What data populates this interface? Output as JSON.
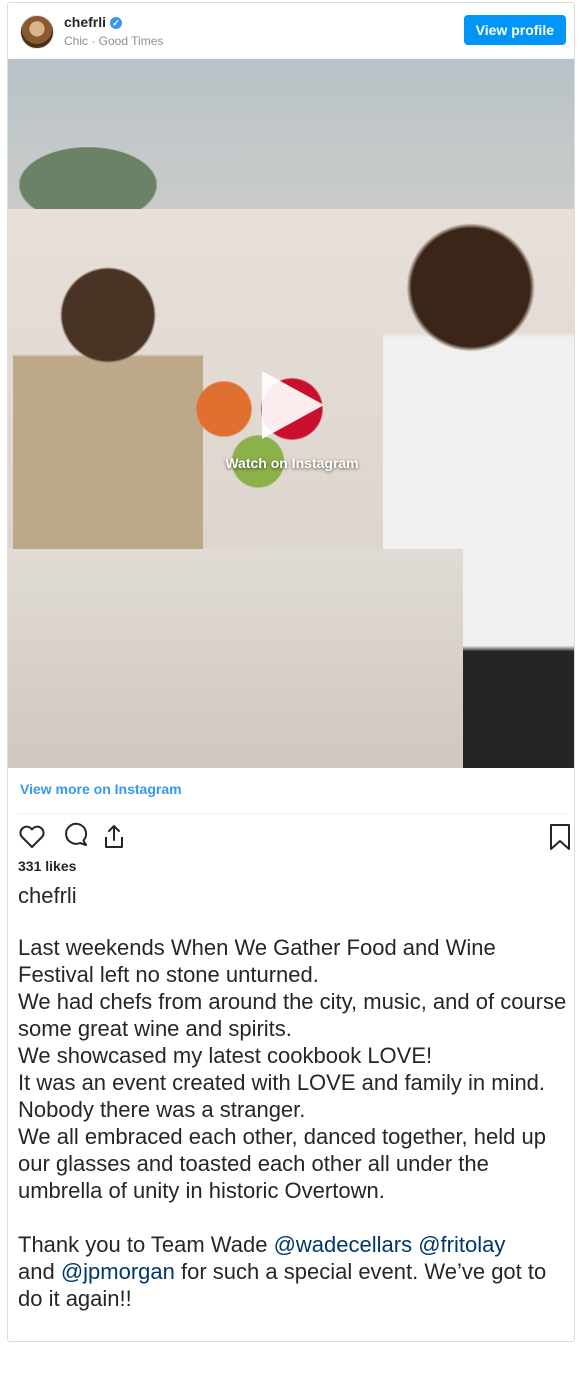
{
  "header": {
    "username": "chefrli",
    "verified_icon": "verified-badge-icon",
    "subtitle": "Chic · Good Times",
    "view_profile_label": "View profile"
  },
  "media": {
    "overlay_label": "Watch on Instagram",
    "play_icon": "play-icon"
  },
  "links": {
    "view_more": "View more on Instagram"
  },
  "actions": {
    "icons": [
      "heart-icon",
      "comment-icon",
      "share-icon",
      "bookmark-icon"
    ]
  },
  "post": {
    "likes": "331 likes",
    "caption_user": "chefrli",
    "caption_part1": "Last weekends When We Gather Food and Wine Festival left no stone unturned.\nWe had chefs from around the city, music, and of course some great wine and spirits.\nWe showcased my latest cookbook LOVE!\nIt was an event created with LOVE and family in mind. Nobody there was a stranger.\nWe all embraced each other, danced together, held up our glasses and toasted each other all under the umbrella of unity in historic Overtown.\n\nThank you to Team Wade ",
    "mention_1": "@wadecellars",
    "mention_2": "@fritolay",
    "text_and": "and ",
    "mention_3": "@jpmorgan",
    "caption_part2": " for such a special event. We’ve got to do it again!!"
  },
  "colors": {
    "accent": "#0095f6",
    "link": "#3897f0",
    "mention": "#00376b",
    "text": "#262626",
    "muted": "#8e8e8e"
  }
}
